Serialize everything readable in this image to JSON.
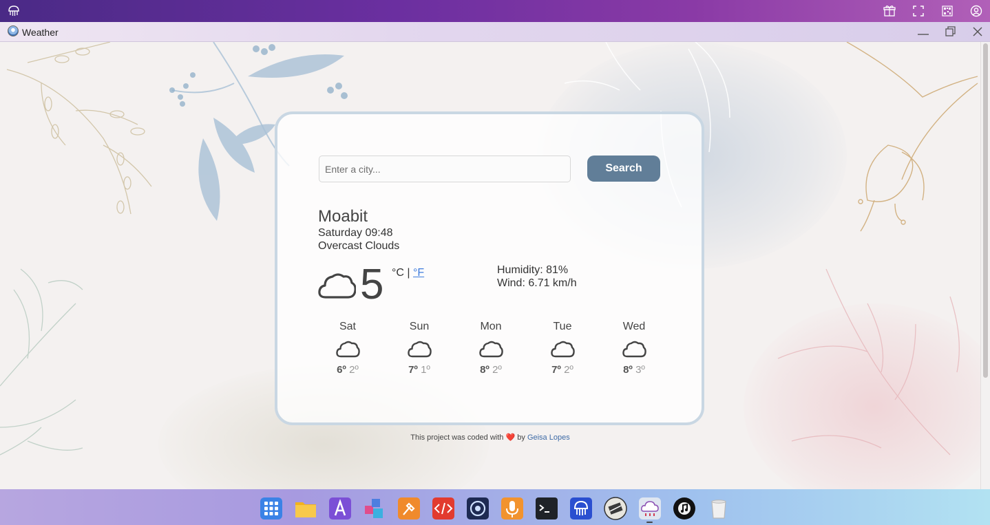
{
  "window": {
    "title": "Weather"
  },
  "search": {
    "placeholder": "Enter a city...",
    "button_label": "Search"
  },
  "current": {
    "city": "Moabit",
    "datetime": "Saturday 09:48",
    "description": "Overcast Clouds",
    "temperature": "5",
    "unit_celsius": "°C",
    "unit_separator": " | ",
    "unit_fahrenheit": "°F",
    "humidity": "Humidity: 81%",
    "wind": "Wind: 6.71 km/h",
    "icon": "cloud-icon"
  },
  "forecast": [
    {
      "day": "Sat",
      "max": "6º",
      "min": "2º",
      "icon": "cloud-icon"
    },
    {
      "day": "Sun",
      "max": "7º",
      "min": "1º",
      "icon": "cloud-icon"
    },
    {
      "day": "Mon",
      "max": "8º",
      "min": "2º",
      "icon": "cloud-icon"
    },
    {
      "day": "Tue",
      "max": "7º",
      "min": "2º",
      "icon": "cloud-icon"
    },
    {
      "day": "Wed",
      "max": "8º",
      "min": "3º",
      "icon": "cloud-icon"
    }
  ],
  "footer": {
    "text_before": "This project was coded with",
    "heart": "❤️",
    "text_by": "by",
    "author": "Geisa Lopes"
  },
  "dock": [
    "app-grid-icon",
    "file-manager-icon",
    "text-editor-icon",
    "3d-cubes-icon",
    "paint-brush-icon",
    "code-editor-icon",
    "camera-icon",
    "microphone-icon",
    "terminal-icon",
    "jellyfish-icon",
    "tool-app-icon",
    "weather-app-icon",
    "music-player-icon",
    "trash-icon"
  ],
  "colors": {
    "accent_button": "#617e98",
    "card_border": "#c9d7e3",
    "link": "#3d7bdc"
  }
}
